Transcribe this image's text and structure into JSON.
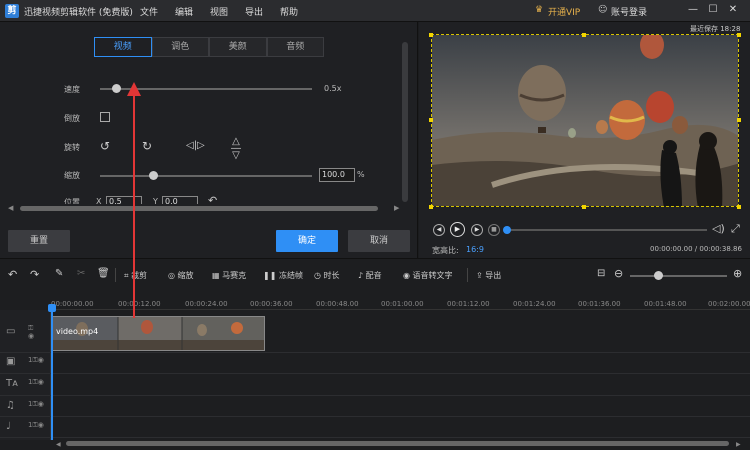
{
  "app": {
    "title": "迅捷视频剪辑软件 (免费版)",
    "logo_glyph": "剪"
  },
  "menu": [
    "文件",
    "编辑",
    "视图",
    "导出",
    "帮助"
  ],
  "account": {
    "vip": "开通VIP",
    "login": "账号登录"
  },
  "window_controls": {
    "minimize": "—",
    "maximize": "☐",
    "close": "✕"
  },
  "autosave": "最近保存 18:28",
  "edit_tabs": [
    "视频",
    "调色",
    "美颜",
    "音频"
  ],
  "props": {
    "speed_label": "速度",
    "speed_value": "0.5x",
    "speed_fraction": 0.08,
    "reverse_label": "倒放",
    "rotate_label": "旋转",
    "zoom_label": "缩放",
    "zoom_value": "100.0",
    "zoom_unit": "%",
    "zoom_fraction": 0.25,
    "position_label": "位置",
    "pos_x_label": "X",
    "pos_x": "0.5",
    "pos_y_label": "Y",
    "pos_y": "0.0"
  },
  "buttons": {
    "reset": "重置",
    "confirm": "确定",
    "cancel": "取消"
  },
  "preview": {
    "aspect_label": "宽高比:",
    "aspect_value": "16:9",
    "time": "00:00:00.00 / 00:00:38.86"
  },
  "toolbar": {
    "crop": "裁剪",
    "zoom": "缩放",
    "mosaic": "马赛克",
    "freeze": "冻结帧",
    "duration": "时长",
    "dub": "配音",
    "speech_to_text": "语音转文字",
    "export": "导出"
  },
  "ruler": [
    "00:00:00.00",
    "00:00:12.00",
    "00:00:24.00",
    "00:00:36.00",
    "00:00:48.00",
    "00:01:00.00",
    "00:01:12.00",
    "00:01:24.00",
    "00:01:36.00",
    "00:01:48.00",
    "00:02:00.00"
  ],
  "clip": {
    "name": "video.mp4"
  },
  "colors": {
    "accent": "#2f8ff5",
    "vip": "#e7b24c",
    "arrow": "#e23636"
  }
}
